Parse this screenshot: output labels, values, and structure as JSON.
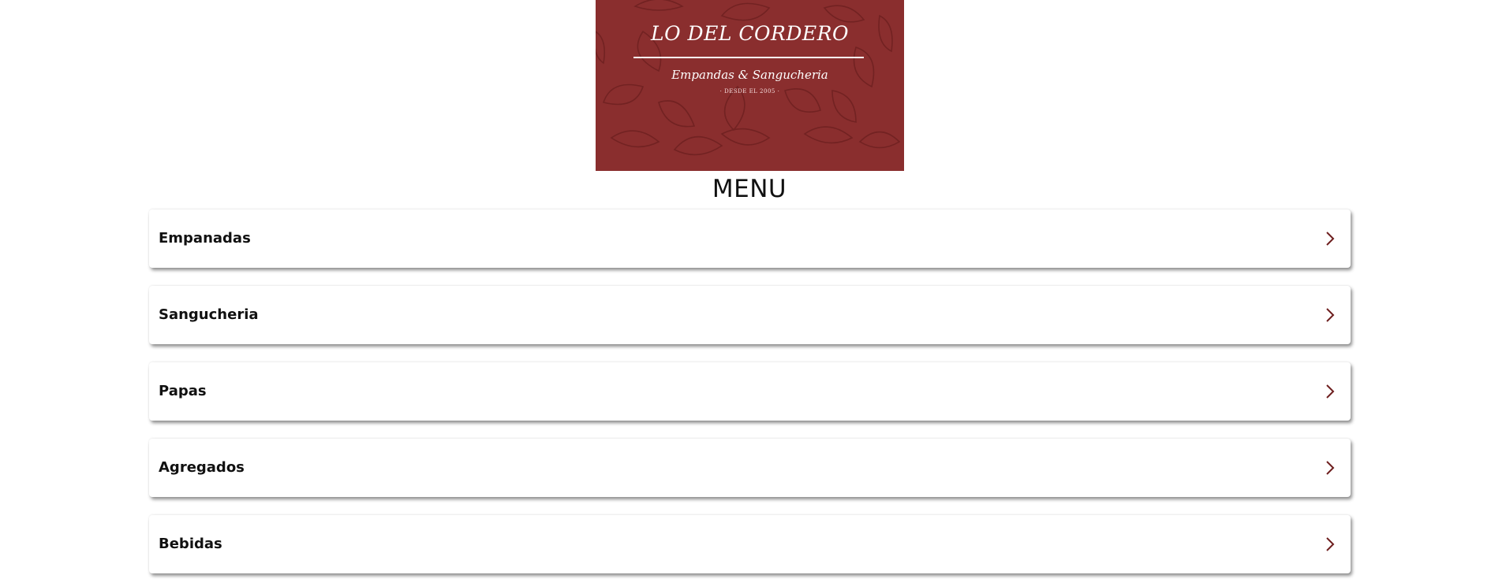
{
  "banner": {
    "title": "LO DEL CORDERO",
    "subtitle": "Empandas & Sangucheria",
    "since": "· DESDE EL 2005 ·",
    "background_color": "#8a2e2e",
    "pattern_icon": "empanada-pattern"
  },
  "menu": {
    "heading": "MENU",
    "accent_color": "#6e1f1f",
    "items": [
      {
        "label": "Empanadas",
        "icon": "chevron-right-icon"
      },
      {
        "label": "Sangucheria",
        "icon": "chevron-right-icon"
      },
      {
        "label": "Papas",
        "icon": "chevron-right-icon"
      },
      {
        "label": "Agregados",
        "icon": "chevron-right-icon"
      },
      {
        "label": "Bebidas",
        "icon": "chevron-right-icon"
      }
    ]
  }
}
